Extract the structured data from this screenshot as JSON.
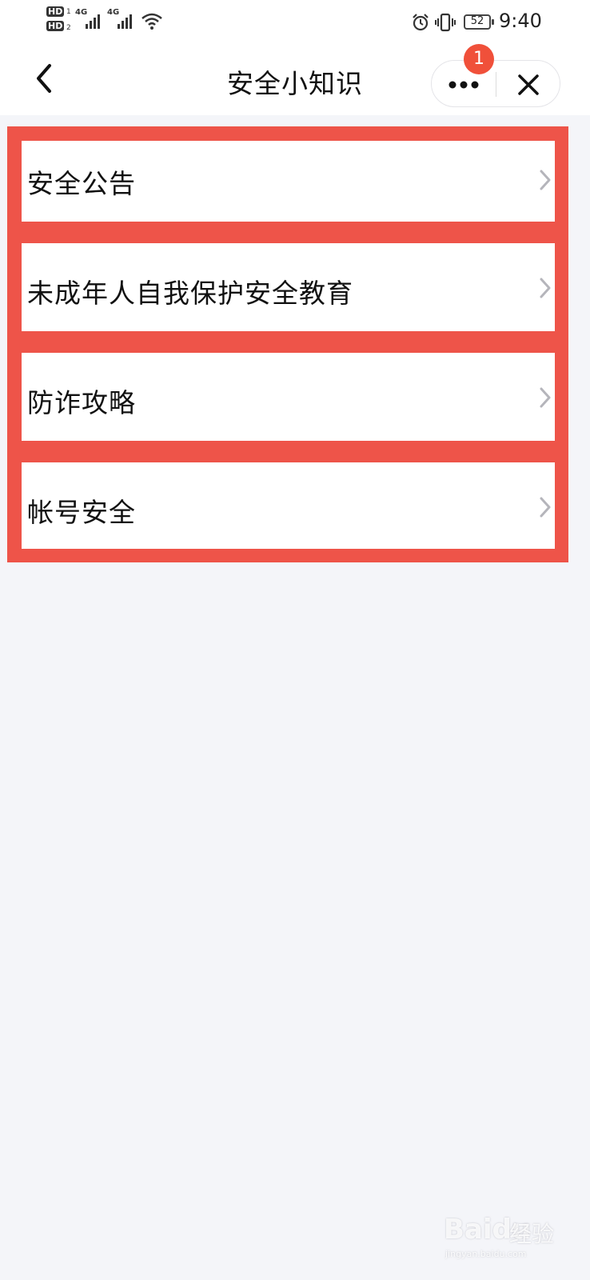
{
  "status_bar": {
    "hd1": "HD",
    "hd1_sub": "1",
    "hd2": "HD",
    "hd2_sub": "2",
    "signal1_label": "4G",
    "signal2_label": "4G",
    "battery": "52",
    "time": "9:40",
    "icons": [
      "hd-icon",
      "signal-icon",
      "wifi-icon",
      "alarm-icon",
      "vibrate-icon",
      "battery-icon"
    ]
  },
  "nav": {
    "title": "安全小知识",
    "badge_count": "1",
    "icons": [
      "back-icon",
      "more-icon",
      "close-icon"
    ]
  },
  "list": {
    "items": [
      {
        "label": "安全公告"
      },
      {
        "label": "未成年人自我保护安全教育"
      },
      {
        "label": "防诈攻略"
      },
      {
        "label": "帐号安全"
      }
    ]
  },
  "colors": {
    "highlight": "#ee5449",
    "badge": "#f0503a",
    "background": "#f4f5f9"
  },
  "watermark": {
    "logo": "Baidu",
    "cn": "经验",
    "url": "jingyan.baidu.com"
  }
}
